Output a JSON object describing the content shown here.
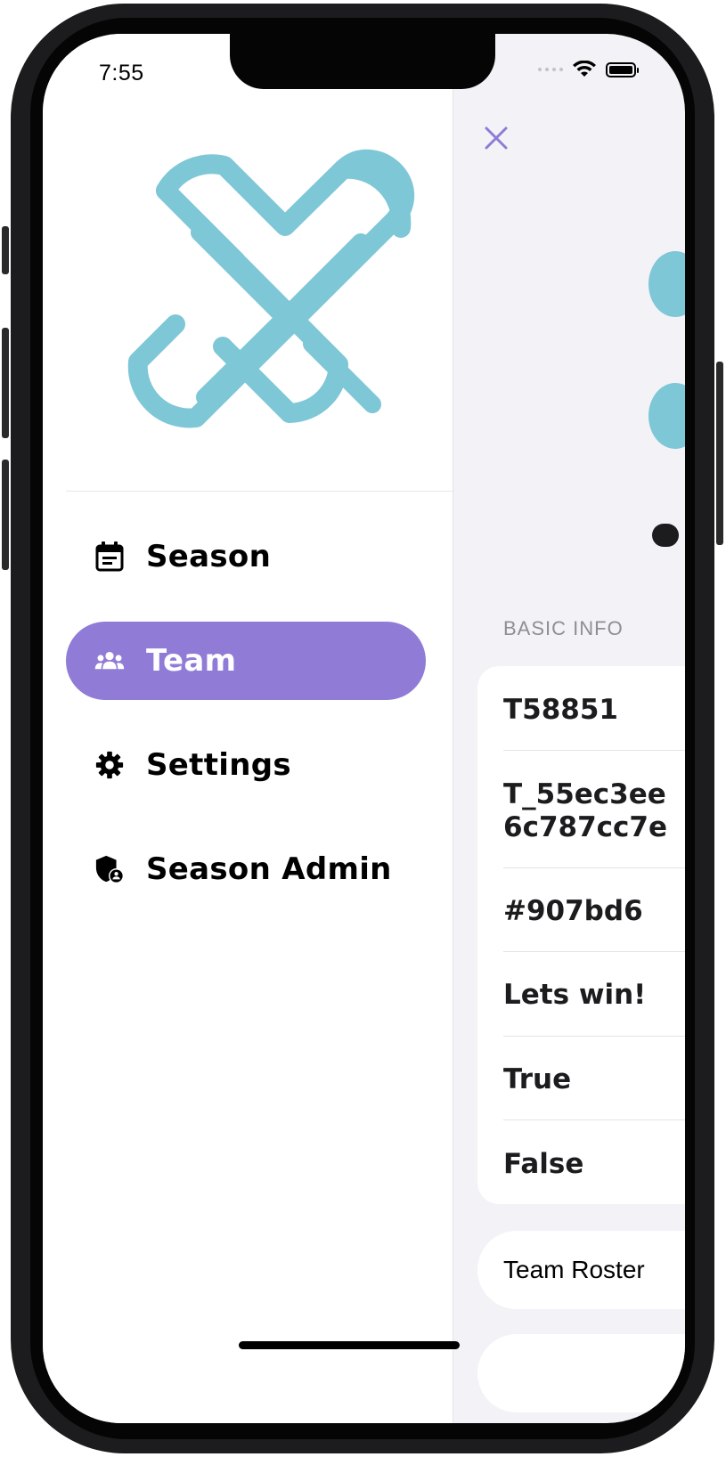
{
  "status_bar": {
    "time": "7:55"
  },
  "menu": {
    "items": [
      {
        "label": "Season",
        "icon": "calendar-icon",
        "active": false
      },
      {
        "label": "Team",
        "icon": "team-icon",
        "active": true
      },
      {
        "label": "Settings",
        "icon": "gear-icon",
        "active": false
      },
      {
        "label": "Season Admin",
        "icon": "admin-shield-icon",
        "active": false
      }
    ]
  },
  "content": {
    "section_header": "BASIC INFO",
    "info_rows": [
      "T58851",
      "T_55ec3ee",
      "6c787cc7e",
      "#907bd6",
      "Lets win!",
      "True",
      "False"
    ],
    "roster_label": "Team Roster"
  },
  "colors": {
    "accent": "#907bd6",
    "logo": "#7ec7d6",
    "background": "#f2f2f7"
  }
}
